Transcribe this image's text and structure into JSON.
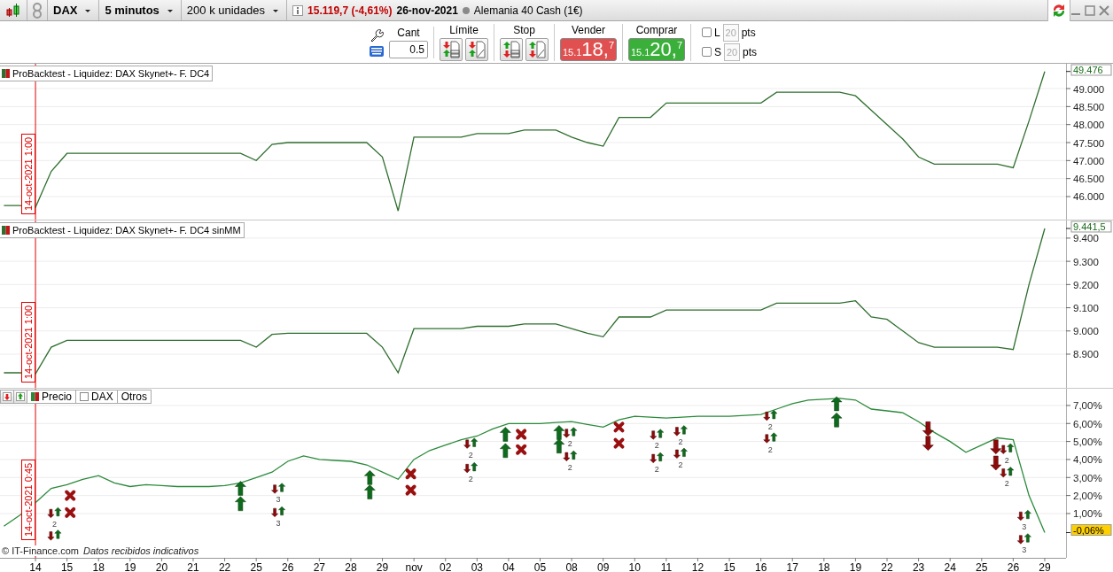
{
  "top_bar": {
    "symbol": "DAX",
    "timeframe": "5 minutos",
    "units": "200 k unidades",
    "price": "15.119,7",
    "change": "(-4,61%)",
    "date": "26-nov-2021",
    "instrument": "Alemania 40 Cash (1€)"
  },
  "order_bar": {
    "quantity_label": "Cant",
    "quantity": "0.5",
    "limit_label": "Límite",
    "stop_label": "Stop",
    "sell": {
      "label": "Vender",
      "prefix": "15.1",
      "big": "18,",
      "sup": "7"
    },
    "buy": {
      "label": "Comprar",
      "prefix": "15.1",
      "big": "20,",
      "sup": "7"
    },
    "toggles": [
      {
        "label": "L",
        "checked": false,
        "value": "20",
        "disabled": true,
        "unit": "pts"
      },
      {
        "label": "S",
        "checked": false,
        "value": "20",
        "disabled": true,
        "unit": "pts"
      }
    ]
  },
  "panels": [
    {
      "cursor_label": "14-oct-2021 1:00",
      "last_label": "49.476",
      "chart_data": {
        "type": "line",
        "grid": true,
        "ylim": [
          45360,
          49690
        ],
        "yticks": [
          {
            "value": 46000,
            "label": "46.000"
          },
          {
            "value": 46500,
            "label": "46.500"
          },
          {
            "value": 47000,
            "label": "47.000"
          },
          {
            "value": 47500,
            "label": "47.500"
          },
          {
            "value": 48000,
            "label": "48.000"
          },
          {
            "value": 48500,
            "label": "48.500"
          },
          {
            "value": 49000,
            "label": "49.000"
          }
        ],
        "categories": [
          null,
          null,
          null,
          null,
          null,
          null,
          null,
          null,
          null,
          null,
          null,
          null,
          null,
          null,
          null,
          null,
          null,
          null,
          null,
          null,
          null,
          null,
          null,
          null,
          null,
          null,
          null,
          null,
          null,
          null,
          null,
          null,
          null,
          null,
          null,
          null,
          null,
          null,
          null,
          null,
          null,
          null,
          null,
          null,
          null,
          null,
          null,
          null,
          null,
          null,
          null,
          null,
          null,
          null,
          null,
          null,
          null,
          null,
          null,
          null,
          null,
          null,
          null,
          null,
          null,
          null,
          null,
          null
        ],
        "series": [
          {
            "name": "ProBacktest - Liquidez: DAX Skynet+- F. DC4",
            "color": "#2e6e2e",
            "values": [
              45750,
              45750,
              45700,
              46700,
              47200,
              47200,
              47200,
              47200,
              47200,
              47200,
              47200,
              47200,
              47200,
              47200,
              47200,
              47200,
              47000,
              47450,
              47500,
              47500,
              47500,
              47500,
              47500,
              47500,
              47100,
              45600,
              47650,
              47650,
              47650,
              47650,
              47750,
              47750,
              47750,
              47850,
              47850,
              47850,
              47650,
              47500,
              47400,
              48200,
              48200,
              48200,
              48600,
              48600,
              48600,
              48600,
              48600,
              48600,
              48600,
              48900,
              48900,
              48900,
              48900,
              48900,
              48800,
              48400,
              48000,
              47600,
              47100,
              46900,
              46900,
              46900,
              46900,
              46900,
              46800,
              48100,
              49476,
              null
            ]
          }
        ]
      }
    },
    {
      "cursor_label": "14-oct-2021 1:00",
      "last_label": "9.441,5",
      "chart_data": {
        "type": "line",
        "grid": true,
        "ylim": [
          8755,
          9476
        ],
        "yticks": [
          {
            "value": 8900,
            "label": "8.900"
          },
          {
            "value": 9000,
            "label": "9.000"
          },
          {
            "value": 9100,
            "label": "9.100"
          },
          {
            "value": 9200,
            "label": "9.200"
          },
          {
            "value": 9300,
            "label": "9.300"
          },
          {
            "value": 9400,
            "label": "9.400"
          }
        ],
        "categories": [
          null,
          null,
          null,
          null,
          null,
          null,
          null,
          null,
          null,
          null,
          null,
          null,
          null,
          null,
          null,
          null,
          null,
          null,
          null,
          null,
          null,
          null,
          null,
          null,
          null,
          null,
          null,
          null,
          null,
          null,
          null,
          null,
          null,
          null,
          null,
          null,
          null,
          null,
          null,
          null,
          null,
          null,
          null,
          null,
          null,
          null,
          null,
          null,
          null,
          null,
          null,
          null,
          null,
          null,
          null,
          null,
          null,
          null,
          null,
          null,
          null,
          null,
          null,
          null,
          null,
          null,
          null,
          null
        ],
        "series": [
          {
            "name": "ProBacktest - Liquidez: DAX Skynet+- F. DC4 sinMM",
            "color": "#2e6e2e",
            "values": [
              8820,
              8820,
              8815,
              8930,
              8960,
              8960,
              8960,
              8960,
              8960,
              8960,
              8960,
              8960,
              8960,
              8960,
              8960,
              8960,
              8930,
              8985,
              8990,
              8990,
              8990,
              8990,
              8990,
              8990,
              8930,
              8820,
              9010,
              9010,
              9010,
              9010,
              9020,
              9020,
              9020,
              9030,
              9030,
              9030,
              9010,
              8990,
              8975,
              9060,
              9060,
              9060,
              9090,
              9090,
              9090,
              9090,
              9090,
              9090,
              9090,
              9120,
              9120,
              9120,
              9120,
              9120,
              9130,
              9060,
              9050,
              9000,
              8950,
              8930,
              8930,
              8930,
              8930,
              8930,
              8920,
              9200,
              9441.5,
              null
            ]
          }
        ]
      }
    },
    {
      "cursor_label": "14-oct-2021 0:45",
      "last_label": "-0,06%",
      "legend": {
        "symbol_label": "DAX",
        "symbol_checked": false,
        "other_label": "Otros"
      },
      "signals": [
        {
          "kind": "pair",
          "label": "2"
        },
        {
          "kind": "pair"
        },
        {
          "kind": "exit"
        },
        {
          "kind": "exit"
        },
        {
          "kind": "buy"
        },
        {
          "kind": "buy"
        },
        {
          "kind": "pair",
          "label": "3"
        },
        {
          "kind": "pair",
          "label": "3"
        },
        {
          "kind": "buy"
        },
        {
          "kind": "buy"
        },
        {
          "kind": "exit"
        },
        {
          "kind": "exit"
        },
        {
          "kind": "pair",
          "label": "2"
        },
        {
          "kind": "pair",
          "label": "2"
        },
        {
          "kind": "buy"
        },
        {
          "kind": "buy"
        },
        {
          "kind": "exit"
        },
        {
          "kind": "exit"
        },
        {
          "kind": "buy"
        },
        {
          "kind": "buy"
        },
        {
          "kind": "pair",
          "label": "2"
        },
        {
          "kind": "pair",
          "label": "2"
        },
        {
          "kind": "exit"
        },
        {
          "kind": "exit"
        },
        {
          "kind": "pair",
          "label": "2"
        },
        {
          "kind": "pair",
          "label": "2"
        },
        {
          "kind": "pair",
          "label": "2"
        },
        {
          "kind": "pair",
          "label": "2"
        },
        {
          "kind": "pair",
          "label": "2"
        },
        {
          "kind": "pair",
          "label": "2"
        },
        {
          "kind": "buy"
        },
        {
          "kind": "buy"
        },
        {
          "kind": "sell"
        },
        {
          "kind": "sell"
        },
        {
          "kind": "sell"
        },
        {
          "kind": "sell"
        },
        {
          "kind": "pair",
          "label": "2"
        },
        {
          "kind": "pair",
          "label": "2"
        },
        {
          "kind": "pair",
          "label": "3"
        },
        {
          "kind": "pair",
          "label": "3"
        }
      ],
      "chart_data": {
        "type": "line",
        "grid": true,
        "ylim": [
          -1.46,
          7.93
        ],
        "yticks": [
          {
            "value": 1,
            "label": "1,00%"
          },
          {
            "value": 2,
            "label": "2,00%"
          },
          {
            "value": 3,
            "label": "3,00%"
          },
          {
            "value": 4,
            "label": "4,00%"
          },
          {
            "value": 5,
            "label": "5,00%"
          },
          {
            "value": 6,
            "label": "6,00%"
          },
          {
            "value": 7,
            "label": "7,00%"
          }
        ],
        "categories": [
          null,
          null,
          "14",
          null,
          "15",
          null,
          "18",
          null,
          "19",
          null,
          "20",
          null,
          "21",
          null,
          "22",
          null,
          "25",
          null,
          "26",
          null,
          "27",
          null,
          "28",
          null,
          "29",
          null,
          "nov",
          null,
          "02",
          null,
          "03",
          null,
          "04",
          null,
          "05",
          null,
          "08",
          null,
          "09",
          null,
          "10",
          null,
          "11",
          null,
          "12",
          null,
          "15",
          null,
          "16",
          null,
          "17",
          null,
          "18",
          null,
          "19",
          null,
          "22",
          null,
          "23",
          null,
          "24",
          null,
          "25",
          null,
          "26",
          null,
          "29",
          null
        ],
        "series": [
          {
            "name": "Precio",
            "color": "#2a8a3a",
            "values": [
              0.3,
              0.9,
              1.6,
              2.4,
              2.6,
              2.9,
              3.1,
              2.7,
              2.5,
              2.6,
              2.55,
              2.5,
              2.5,
              2.5,
              2.55,
              2.7,
              3.0,
              3.3,
              3.9,
              4.2,
              4.0,
              3.95,
              3.9,
              3.7,
              3.3,
              2.9,
              4.0,
              4.5,
              4.8,
              5.1,
              5.3,
              5.7,
              6.0,
              6.0,
              6.0,
              6.05,
              6.1,
              5.95,
              5.8,
              6.2,
              6.4,
              6.35,
              6.3,
              6.35,
              6.4,
              6.4,
              6.4,
              6.45,
              6.5,
              6.8,
              7.1,
              7.3,
              7.35,
              7.4,
              7.3,
              6.8,
              6.7,
              6.6,
              6.1,
              5.5,
              5.0,
              4.4,
              4.8,
              5.2,
              5.1,
              2.0,
              -0.06,
              null
            ]
          }
        ]
      }
    }
  ],
  "footer": {
    "copyright": "© IT-Finance.com",
    "note": "Datos recibidos indicativos"
  }
}
